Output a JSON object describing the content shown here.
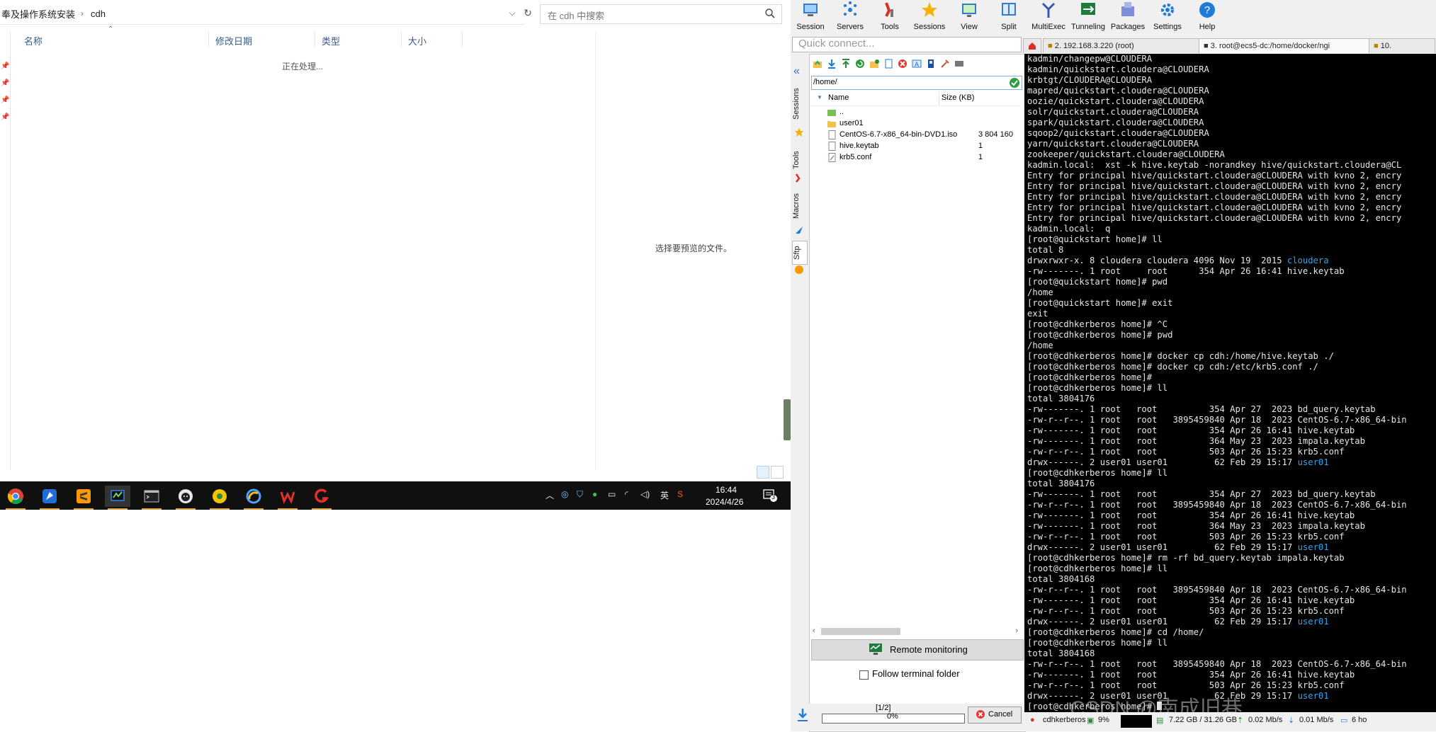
{
  "explorer": {
    "breadcrumb": [
      "奉及操作系统安装",
      "cdh"
    ],
    "search_placeholder": "在 cdh 中搜索",
    "columns": [
      "名称",
      "修改日期",
      "类型",
      "大小"
    ],
    "status_text": "正在处理...",
    "preview_hint": "选择要预览的文件。"
  },
  "taskbar": {
    "apps": [
      "chrome-icon",
      "feishu-icon",
      "sublime-icon",
      "mobaxterm-icon",
      "terminal-icon",
      "github-desktop-icon",
      "yellow-app-icon",
      "browser-icon",
      "wps-icon",
      "red-app-icon"
    ],
    "ime": "英",
    "time": "16:44",
    "date": "2024/4/26",
    "notification_count": "3"
  },
  "moba": {
    "toolbar": [
      "Session",
      "Servers",
      "Tools",
      "Sessions",
      "View",
      "Split",
      "MultiExec",
      "Tunneling",
      "Packages",
      "Settings",
      "Help"
    ],
    "quick_connect_placeholder": "Quick connect...",
    "tabs": [
      "2. 192.168.3.220 (root)",
      "3. root@ecs5-dc:/home/docker/ngi",
      "10. "
    ],
    "side_tabs": [
      "Sessions",
      "Tools",
      "Macros",
      "Sftp"
    ],
    "sftp": {
      "path": "/home/",
      "col_name": "Name",
      "col_size": "Size (KB)",
      "files": [
        {
          "name": "..",
          "size": "",
          "type": "parent"
        },
        {
          "name": "user01",
          "size": "",
          "type": "folder"
        },
        {
          "name": "CentOS-6.7-x86_64-bin-DVD1.iso",
          "size": "3 804 160",
          "type": "file"
        },
        {
          "name": "hive.keytab",
          "size": "1",
          "type": "file"
        },
        {
          "name": "krb5.conf",
          "size": "1",
          "type": "file"
        }
      ],
      "remote_monitoring": "Remote monitoring",
      "follow_terminal": "Follow terminal folder",
      "transfer_fraction": "[1/2]",
      "transfer_percent": "0%",
      "cancel": "Cancel"
    },
    "terminal_lines": [
      "kadmin/changepw@CLOUDERA",
      "kadmin/quickstart.cloudera@CLOUDERA",
      "krbtgt/CLOUDERA@CLOUDERA",
      "mapred/quickstart.cloudera@CLOUDERA",
      "oozie/quickstart.cloudera@CLOUDERA",
      "solr/quickstart.cloudera@CLOUDERA",
      "spark/quickstart.cloudera@CLOUDERA",
      "sqoop2/quickstart.cloudera@CLOUDERA",
      "yarn/quickstart.cloudera@CLOUDERA",
      "zookeeper/quickstart.cloudera@CLOUDERA",
      "kadmin.local:  xst -k hive.keytab -norandkey hive/quickstart.cloudera@CL",
      "Entry for principal hive/quickstart.cloudera@CLOUDERA with kvno 2, encry",
      "Entry for principal hive/quickstart.cloudera@CLOUDERA with kvno 2, encry",
      "Entry for principal hive/quickstart.cloudera@CLOUDERA with kvno 2, encry",
      "Entry for principal hive/quickstart.cloudera@CLOUDERA with kvno 2, encry",
      "Entry for principal hive/quickstart.cloudera@CLOUDERA with kvno 2, encry",
      "kadmin.local:  q",
      "[root@quickstart home]# ll",
      "total 8",
      "drwxrwxr-x. 8 cloudera cloudera 4096 Nov 19  2015 |cloudera",
      "-rw-------. 1 root     root      354 Apr 26 16:41 hive.keytab",
      "[root@quickstart home]# pwd",
      "/home",
      "[root@quickstart home]# exit",
      "exit",
      "[root@cdhkerberos home]# ^C",
      "[root@cdhkerberos home]# pwd",
      "/home",
      "[root@cdhkerberos home]# docker cp cdh:/home/hive.keytab ./",
      "[root@cdhkerberos home]# docker cp cdh:/etc/krb5.conf ./",
      "[root@cdhkerberos home]#",
      "[root@cdhkerberos home]# ll",
      "total 3804176",
      "-rw-------. 1 root   root          354 Apr 27  2023 bd_query.keytab",
      "-rw-r--r--. 1 root   root   3895459840 Apr 18  2023 CentOS-6.7-x86_64-bin",
      "-rw-------. 1 root   root          354 Apr 26 16:41 hive.keytab",
      "-rw-------. 1 root   root          364 May 23  2023 impala.keytab",
      "-rw-r--r--. 1 root   root          503 Apr 26 15:23 krb5.conf",
      "drwx------. 2 user01 user01         62 Feb 29 15:17 |user01",
      "[root@cdhkerberos home]# ll",
      "total 3804176",
      "-rw-------. 1 root   root          354 Apr 27  2023 bd_query.keytab",
      "-rw-r--r--. 1 root   root   3895459840 Apr 18  2023 CentOS-6.7-x86_64-bin",
      "-rw-------. 1 root   root          354 Apr 26 16:41 hive.keytab",
      "-rw-------. 1 root   root          364 May 23  2023 impala.keytab",
      "-rw-r--r--. 1 root   root          503 Apr 26 15:23 krb5.conf",
      "drwx------. 2 user01 user01         62 Feb 29 15:17 |user01",
      "[root@cdhkerberos home]# rm -rf bd_query.keytab impala.keytab",
      "[root@cdhkerberos home]# ll",
      "total 3804168",
      "-rw-r--r--. 1 root   root   3895459840 Apr 18  2023 CentOS-6.7-x86_64-bin",
      "-rw-------. 1 root   root          354 Apr 26 16:41 hive.keytab",
      "-rw-r--r--. 1 root   root          503 Apr 26 15:23 krb5.conf",
      "drwx------. 2 user01 user01         62 Feb 29 15:17 |user01",
      "[root@cdhkerberos home]# cd /home/",
      "[root@cdhkerberos home]# ll",
      "total 3804168",
      "-rw-r--r--. 1 root   root   3895459840 Apr 18  2023 CentOS-6.7-x86_64-bin",
      "-rw-------. 1 root   root          354 Apr 26 16:41 hive.keytab",
      "-rw-r--r--. 1 root   root          503 Apr 26 15:23 krb5.conf",
      "drwx------. 2 user01 user01         62 Feb 29 15:17 |user01",
      "[root@cdhkerberos home]# "
    ],
    "watermark": "CSDN @南成旧巷",
    "status": {
      "host": "cdhkerberos",
      "cpu": "9%",
      "memory": "7.22 GB / 31.26 GB",
      "upload": "0.02 Mb/s",
      "download": "0.01 Mb/s",
      "uptime": "6 ho"
    },
    "colors": {
      "terminal_bg": "#000000",
      "terminal_fg": "#e6e6e6",
      "dir_color": "#34a4e8"
    }
  }
}
